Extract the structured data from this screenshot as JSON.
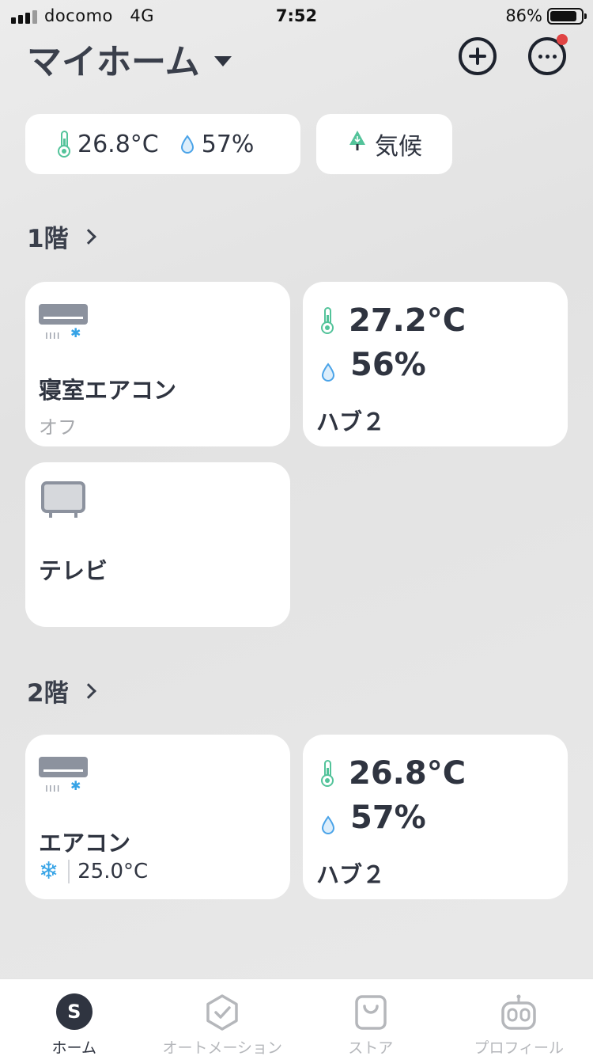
{
  "status_bar": {
    "carrier": "docomo",
    "network": "4G",
    "time": "7:52",
    "battery": "86%"
  },
  "header": {
    "title": "マイホーム",
    "add_icon": "plus-circle-icon",
    "more_icon": "more-dots-icon",
    "notification_color": "#e04444"
  },
  "weather": {
    "temperature": "26.8°C",
    "humidity": "57%",
    "climate_label": "気候"
  },
  "floors": [
    {
      "name": "1階",
      "devices": [
        {
          "type": "air-conditioner",
          "name": "寝室エアコン",
          "status": "オフ"
        },
        {
          "type": "hub",
          "temperature": "27.2°C",
          "humidity": "56%",
          "name": "ハブ２"
        },
        {
          "type": "tv",
          "name": "テレビ"
        }
      ]
    },
    {
      "name": "2階",
      "devices": [
        {
          "type": "air-conditioner",
          "name": "エアコン",
          "mode_icon": "snowflake-icon",
          "setpoint": "25.0°C"
        },
        {
          "type": "hub",
          "temperature": "26.8°C",
          "humidity": "57%",
          "name": "ハブ２"
        }
      ]
    }
  ],
  "tabs": [
    {
      "label": "ホーム",
      "icon": "home-s-icon",
      "active": true
    },
    {
      "label": "オートメーション",
      "icon": "automation-icon",
      "active": false
    },
    {
      "label": "ストア",
      "icon": "store-bag-icon",
      "active": false
    },
    {
      "label": "プロフィール",
      "icon": "robot-profile-icon",
      "active": false
    }
  ],
  "colors": {
    "thermometer": "#53c39a",
    "humidity": "#4aa3e8",
    "accent_dark": "#2f3440",
    "card": "#ffffff"
  }
}
